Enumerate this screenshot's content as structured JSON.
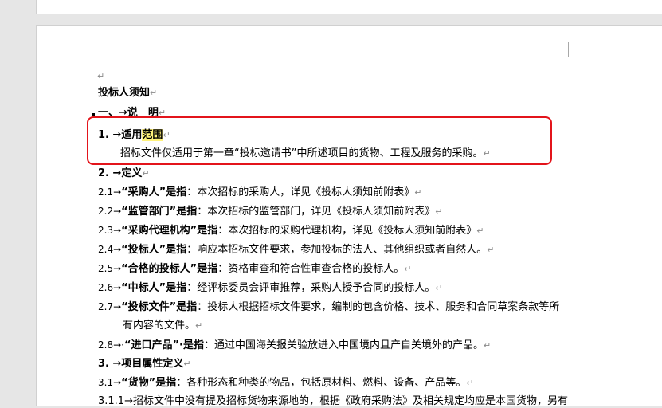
{
  "paragraph_mark": "↵",
  "lines": {
    "empty": "↵",
    "title": "投标人须知",
    "sec1": "一、→说　明",
    "sec1_1_num": "1. →",
    "sec1_1_title_a": "适用",
    "sec1_1_title_hl": "范围",
    "sec1_1_body": "招标文件仅适用于第一章“投标邀请书”中所述项目的货物、工程及服务的采购。",
    "sec2_title": "2. →定义",
    "d21_num": "2.1→",
    "d21_b": "“采购人”是指",
    "d21_t": "：本次招标的采购人，详见《投标人须知前附表》",
    "d22_num": "2.2→",
    "d22_b": "“监管部门”是指",
    "d22_t": "：本次招标的监管部门，详见《投标人须知前附表》",
    "d23_num": "2.3→",
    "d23_b": "“采购代理机构”是指",
    "d23_t": "：本次招标的采购代理机构，详见《投标人须知前附表》",
    "d24_num": "2.4→",
    "d24_b": "“投标人”是指",
    "d24_t": "：响应本招标文件要求，参加投标的法人、其他组织或者自然人。",
    "d25_num": "2.5→",
    "d25_b": "“合格的投标人”是指",
    "d25_t": "：资格审查和符合性审查合格的投标人。",
    "d26_num": "2.6→",
    "d26_b": "“中标人”是指",
    "d26_t": "：经评标委员会评审推荐，采购人授予合同的投标人。",
    "d27_num": "2.7→",
    "d27_b": "“投标文件”是指",
    "d27_t": "：投标人根据招标文件要求，编制的包含价格、技术、服务和合同草案条款等所",
    "d27_t2": "有内容的文件。",
    "d28_num": "2.8→·",
    "d28_b": "“进口产品”·是指",
    "d28_t": "：通过中国海关报关验放进入中国境内且产自关境外的产品。",
    "sec3_title": "3. →项目属性定义",
    "d31_num": "3.1→",
    "d31_b": "“货物”是指",
    "d31_t": "：各种形态和种类的物品，包括原材料、燃料、设备、产品等。",
    "d311": "3.1.1→招标文件中没有提及招标货物来源地的，根据《政府采购法》及相关规定均应是本国货物，另有"
  }
}
